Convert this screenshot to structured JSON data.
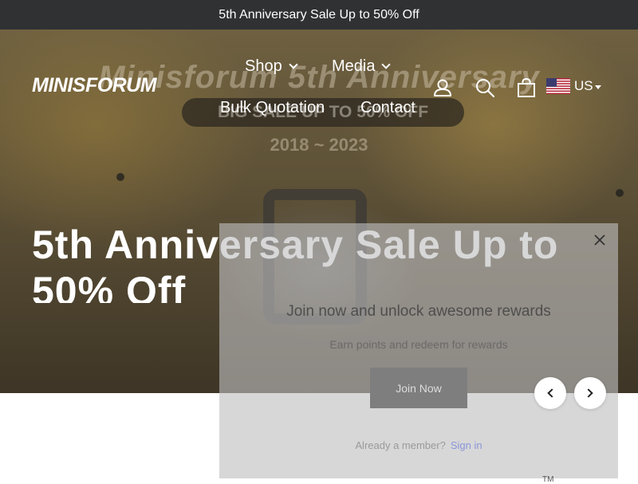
{
  "announcement": {
    "text": "5th Anniversary Sale Up to 50% Off"
  },
  "hero_image": {
    "line1": "Minisforum 5th Anniversary",
    "line2": "BIG SALE UP TO 50% OFF",
    "line3": "2018 ~ 2023"
  },
  "header": {
    "logo": "MINISFORUM",
    "nav": [
      {
        "label": "Shop"
      },
      {
        "label": "Media"
      },
      {
        "label": "Bulk Quotation"
      },
      {
        "label": "Contact"
      }
    ],
    "currency": "US",
    "icons": [
      "account-icon",
      "search-icon",
      "cart-icon",
      "us-flag-icon"
    ]
  },
  "hero": {
    "headline": "5th Anniversary Sale Up to 50% Off"
  },
  "popup": {
    "title": "Join now and unlock awesome rewards",
    "subtitle": "Earn points and redeem for rewards",
    "join_button": "Join Now",
    "member_text": "Already a member?",
    "signin_link": "Sign in",
    "tag": "TM"
  },
  "colors": {
    "announcement_bg": "#2f3133",
    "link": "#8a96d8",
    "hero_text": "#ffffff"
  }
}
